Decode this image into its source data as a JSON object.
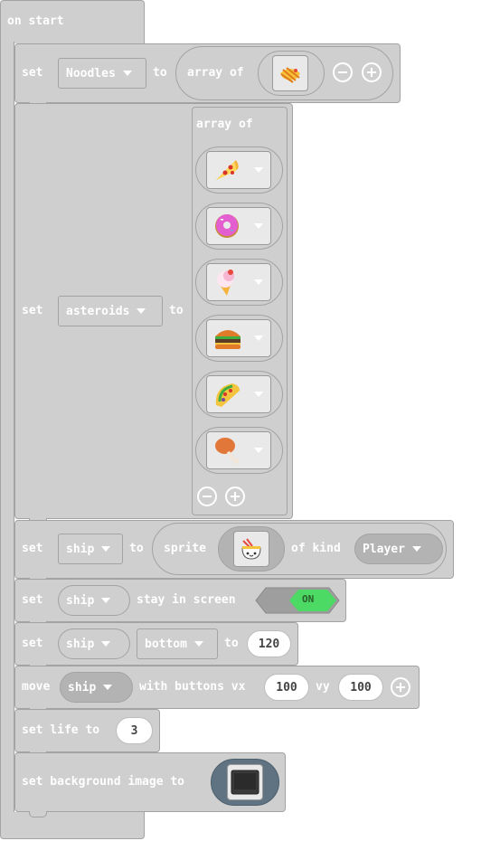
{
  "on_start": {
    "label": "on start"
  },
  "blocks": {
    "noodles": {
      "set": "set",
      "var": "Noodles",
      "to": "to",
      "array_of": "array of",
      "image": "noodles-image"
    },
    "asteroids": {
      "set": "set",
      "var": "asteroids",
      "to": "to",
      "array_of": "array of",
      "images": [
        "pizza-image",
        "donut-image",
        "icecream-image",
        "burger-image",
        "taco-image",
        "drumstick-image"
      ]
    },
    "ship_sprite": {
      "set": "set",
      "var": "ship",
      "to": "to",
      "sprite": "sprite",
      "of_kind": "of kind",
      "kind": "Player",
      "image": "ship-noodle-bowl-image"
    },
    "stay_in_screen": {
      "set": "set",
      "var": "ship",
      "label": "stay in screen",
      "toggle": "ON"
    },
    "bottom": {
      "set": "set",
      "var": "ship",
      "prop": "bottom",
      "to": "to",
      "value": "120"
    },
    "move": {
      "move": "move",
      "var": "ship",
      "with": "with buttons vx",
      "vx": "100",
      "vy_label": "vy",
      "vy": "100"
    },
    "life": {
      "label": "set life to",
      "value": "3"
    },
    "background": {
      "label": "set background image to",
      "image": "background-image"
    }
  },
  "colors": {
    "block": "#cfcfcf",
    "border": "#a3a3a3",
    "toggle_on": "#4cd964"
  }
}
